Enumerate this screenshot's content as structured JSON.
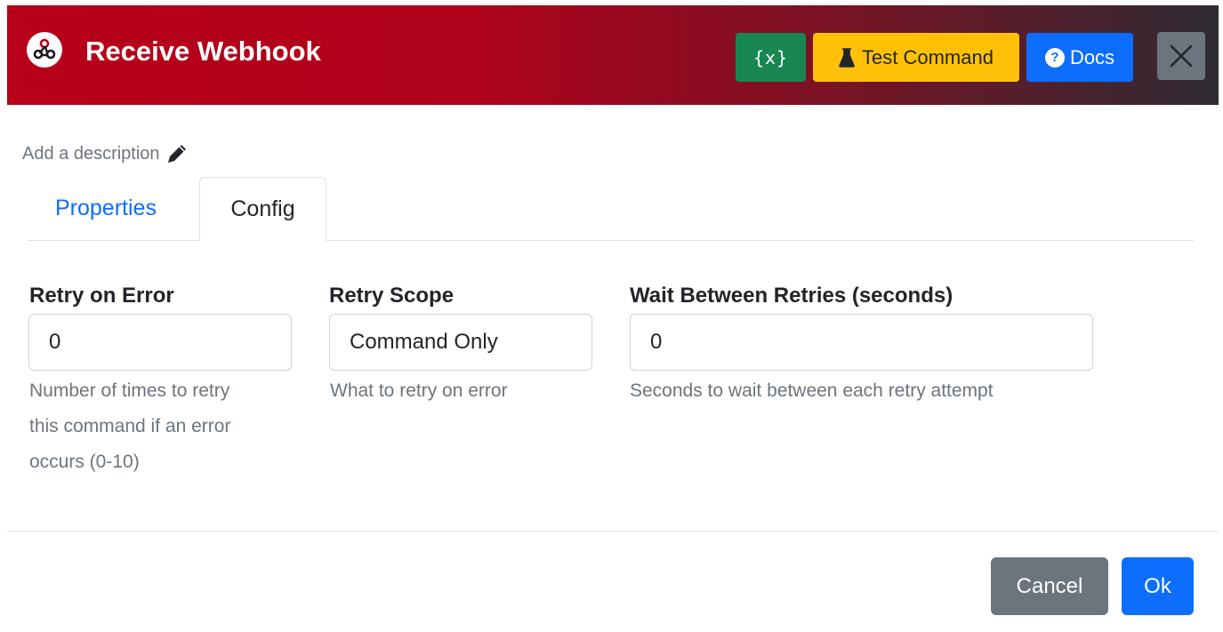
{
  "header": {
    "title": "Receive Webhook",
    "icon": "webhook-icon",
    "variables_label": "{x}",
    "test_label": "Test Command",
    "docs_label": "Docs",
    "close_icon": "close-icon",
    "colors": {
      "header_start": "#b8001a",
      "header_end": "#2e2b33",
      "variables_btn": "#198754",
      "test_btn": "#ffc107",
      "docs_btn": "#0d6efd",
      "close_btn": "#6c757d"
    }
  },
  "description": {
    "placeholder": "Add a description",
    "icon": "pencil-icon"
  },
  "tabs": [
    {
      "label": "Properties",
      "active": false
    },
    {
      "label": "Config",
      "active": true
    }
  ],
  "fields": {
    "retry_on_error": {
      "label": "Retry on Error",
      "value": "0",
      "help_lines": [
        "Number of times to retry",
        "this command if an error",
        "occurs (0-10)"
      ]
    },
    "retry_scope": {
      "label": "Retry Scope",
      "value": "Command Only",
      "help": "What to retry on error"
    },
    "wait_between": {
      "label": "Wait Between Retries (seconds)",
      "value": "0",
      "help": "Seconds to wait between each retry attempt"
    }
  },
  "footer": {
    "cancel_label": "Cancel",
    "ok_label": "Ok"
  }
}
